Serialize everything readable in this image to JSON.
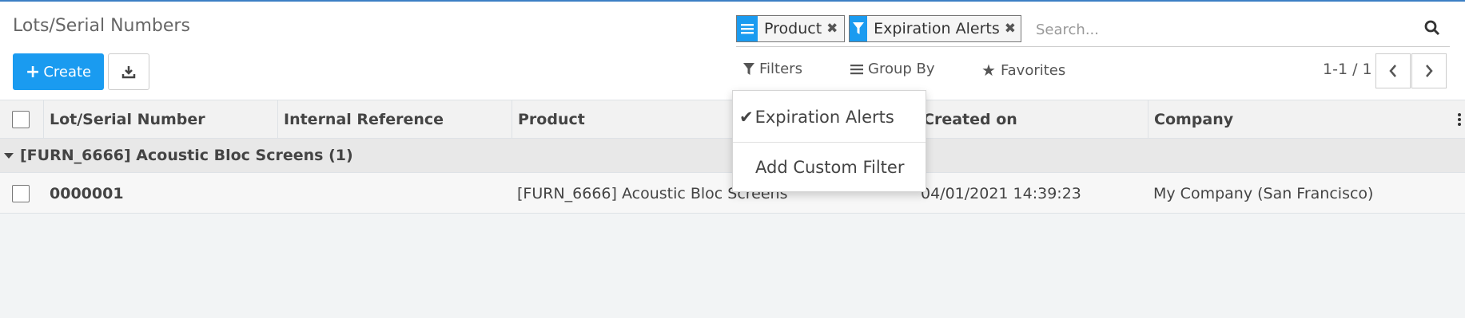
{
  "breadcrumb": {
    "title": "Lots/Serial Numbers"
  },
  "toolbar": {
    "create_label": "Create",
    "create_icon": "plus-icon",
    "download_icon": "download-icon"
  },
  "search": {
    "facets": [
      {
        "label": "Product",
        "icon": "group-by-icon"
      },
      {
        "label": "Expiration Alerts",
        "icon": "filter-icon"
      }
    ],
    "placeholder": "Search...",
    "value": ""
  },
  "menus": {
    "filters": "Filters",
    "group_by": "Group By",
    "favorites": "Favorites"
  },
  "pager": {
    "value": "1-1 / 1"
  },
  "table": {
    "columns": [
      "Lot/Serial Number",
      "Internal Reference",
      "Product",
      "Created on",
      "Company"
    ],
    "group": {
      "label": "[FURN_6666] Acoustic Bloc Screens (1)"
    },
    "rows": [
      {
        "lot": "0000001",
        "internal_ref": "",
        "product": "[FURN_6666] Acoustic Bloc Screens",
        "created_on": "04/01/2021 14:39:23",
        "company": "My Company (San Francisco)"
      }
    ]
  },
  "filters_dropdown": {
    "items": [
      {
        "label": "Expiration Alerts",
        "checked": true
      },
      {
        "label": "Add Custom Filter",
        "checked": false
      }
    ]
  },
  "colors": {
    "accent": "#1a9bf0",
    "topline": "#3b7fc4"
  }
}
